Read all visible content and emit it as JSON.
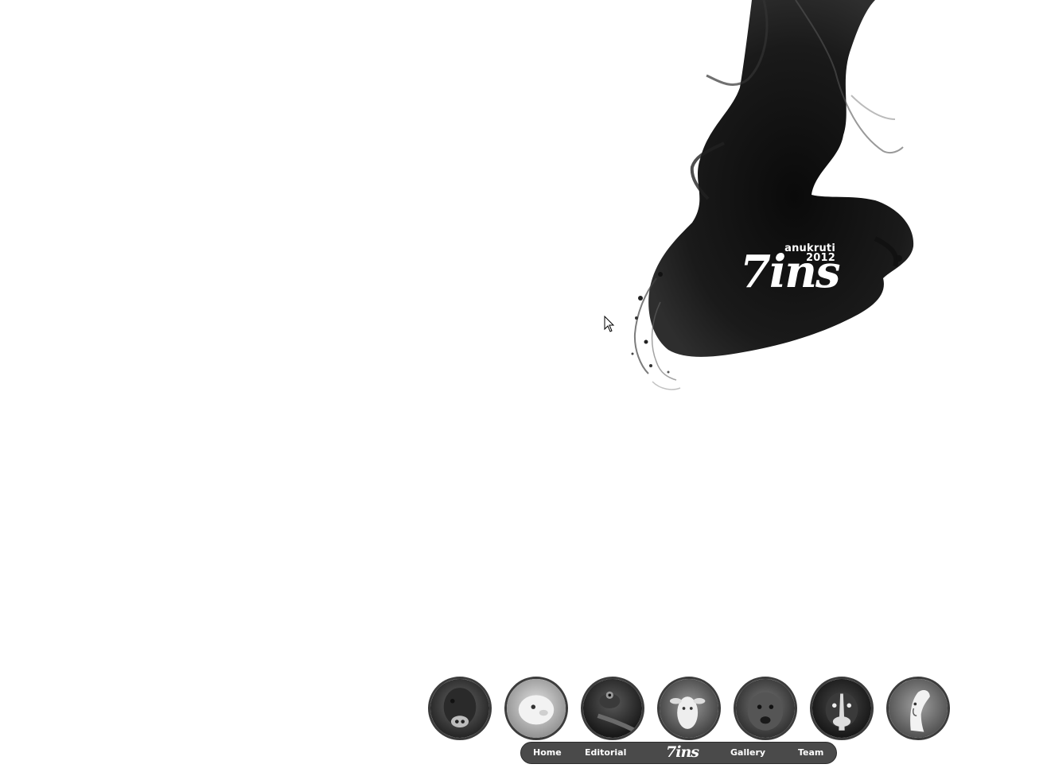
{
  "logo": {
    "line1": "anukruti",
    "line2": "2012",
    "mark": "7ins"
  },
  "nav": {
    "items": [
      {
        "label": "Home"
      },
      {
        "label": "Editorial"
      },
      {
        "label": "Gallery"
      },
      {
        "label": "Team"
      }
    ],
    "logo_mark": "7ins"
  },
  "thumbnails": [
    {
      "name": "bull-thumbnail"
    },
    {
      "name": "lamb-thumbnail"
    },
    {
      "name": "lizard-thumbnail"
    },
    {
      "name": "goat-thumbnail"
    },
    {
      "name": "dog-thumbnail"
    },
    {
      "name": "boxer-dog-thumbnail"
    },
    {
      "name": "horse-thumbnail"
    }
  ],
  "colors": {
    "background": "#ffffff",
    "ink": "#111111",
    "navbar": "#4a4a4a",
    "nav_text": "#ffffff"
  }
}
